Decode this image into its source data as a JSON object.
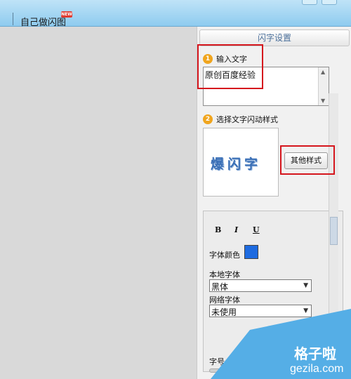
{
  "topbar": {
    "title": "自己做闪图",
    "badge": "NEW"
  },
  "panel": {
    "header": "闪字设置",
    "step1": {
      "num": "1",
      "label": "输入文字"
    },
    "text_value": "原创百度经验",
    "step2": {
      "num": "2",
      "label": "选择文字闪动样式"
    },
    "preview_text": "爆闪字",
    "other_button": "其他样式",
    "format": {
      "bold": "B",
      "italic": "I",
      "underline": "U"
    },
    "font_color_label": "字体颜色",
    "font_color": "#1e6be0",
    "local_font_label": "本地字体",
    "local_font_value": "黑体",
    "web_font_label": "网络字体",
    "web_font_value": "未使用",
    "size_label": "字号"
  },
  "watermark": {
    "brand": "格子啦",
    "url": "gezila.com"
  },
  "highlight_color": "#d5161d"
}
